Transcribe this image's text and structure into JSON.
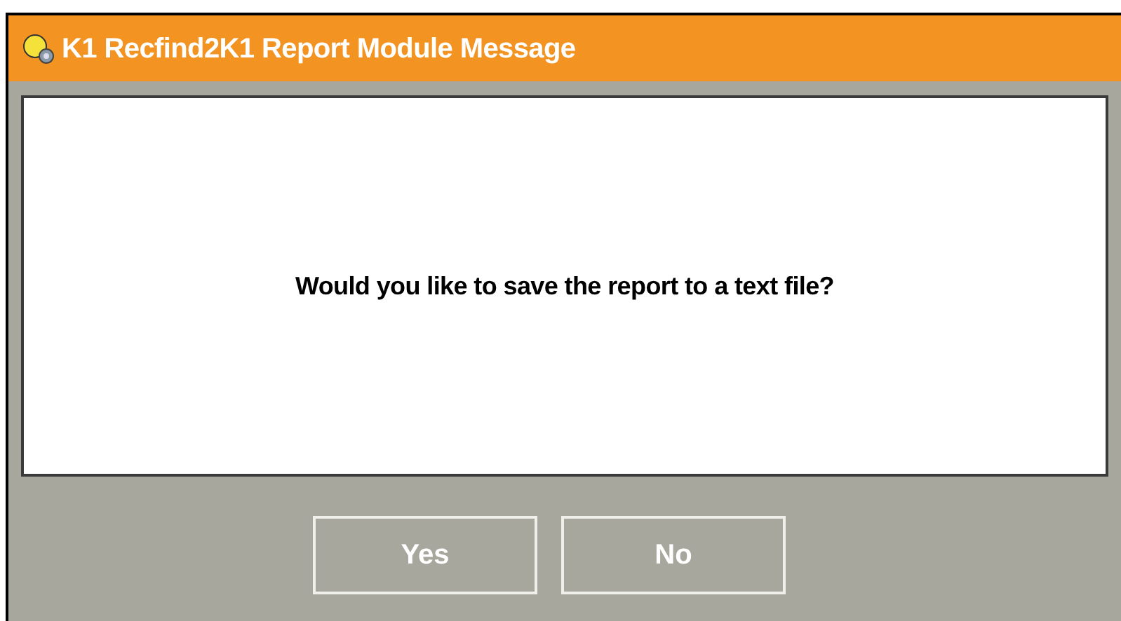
{
  "window": {
    "title": "K1 Recfind2K1 Report Module Message"
  },
  "message": "Would you like to save the report to a text file?",
  "buttons": [
    "Yes",
    "No"
  ]
}
